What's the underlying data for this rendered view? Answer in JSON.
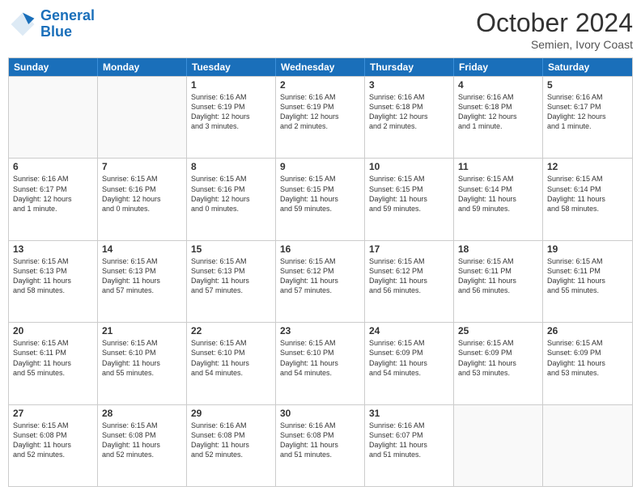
{
  "header": {
    "logo_general": "General",
    "logo_blue": "Blue",
    "month": "October 2024",
    "location": "Semien, Ivory Coast"
  },
  "days_of_week": [
    "Sunday",
    "Monday",
    "Tuesday",
    "Wednesday",
    "Thursday",
    "Friday",
    "Saturday"
  ],
  "weeks": [
    [
      {
        "day": "",
        "empty": true
      },
      {
        "day": "",
        "empty": true
      },
      {
        "day": "1",
        "lines": [
          "Sunrise: 6:16 AM",
          "Sunset: 6:19 PM",
          "Daylight: 12 hours",
          "and 3 minutes."
        ]
      },
      {
        "day": "2",
        "lines": [
          "Sunrise: 6:16 AM",
          "Sunset: 6:19 PM",
          "Daylight: 12 hours",
          "and 2 minutes."
        ]
      },
      {
        "day": "3",
        "lines": [
          "Sunrise: 6:16 AM",
          "Sunset: 6:18 PM",
          "Daylight: 12 hours",
          "and 2 minutes."
        ]
      },
      {
        "day": "4",
        "lines": [
          "Sunrise: 6:16 AM",
          "Sunset: 6:18 PM",
          "Daylight: 12 hours",
          "and 1 minute."
        ]
      },
      {
        "day": "5",
        "lines": [
          "Sunrise: 6:16 AM",
          "Sunset: 6:17 PM",
          "Daylight: 12 hours",
          "and 1 minute."
        ]
      }
    ],
    [
      {
        "day": "6",
        "lines": [
          "Sunrise: 6:16 AM",
          "Sunset: 6:17 PM",
          "Daylight: 12 hours",
          "and 1 minute."
        ]
      },
      {
        "day": "7",
        "lines": [
          "Sunrise: 6:15 AM",
          "Sunset: 6:16 PM",
          "Daylight: 12 hours",
          "and 0 minutes."
        ]
      },
      {
        "day": "8",
        "lines": [
          "Sunrise: 6:15 AM",
          "Sunset: 6:16 PM",
          "Daylight: 12 hours",
          "and 0 minutes."
        ]
      },
      {
        "day": "9",
        "lines": [
          "Sunrise: 6:15 AM",
          "Sunset: 6:15 PM",
          "Daylight: 11 hours",
          "and 59 minutes."
        ]
      },
      {
        "day": "10",
        "lines": [
          "Sunrise: 6:15 AM",
          "Sunset: 6:15 PM",
          "Daylight: 11 hours",
          "and 59 minutes."
        ]
      },
      {
        "day": "11",
        "lines": [
          "Sunrise: 6:15 AM",
          "Sunset: 6:14 PM",
          "Daylight: 11 hours",
          "and 59 minutes."
        ]
      },
      {
        "day": "12",
        "lines": [
          "Sunrise: 6:15 AM",
          "Sunset: 6:14 PM",
          "Daylight: 11 hours",
          "and 58 minutes."
        ]
      }
    ],
    [
      {
        "day": "13",
        "lines": [
          "Sunrise: 6:15 AM",
          "Sunset: 6:13 PM",
          "Daylight: 11 hours",
          "and 58 minutes."
        ]
      },
      {
        "day": "14",
        "lines": [
          "Sunrise: 6:15 AM",
          "Sunset: 6:13 PM",
          "Daylight: 11 hours",
          "and 57 minutes."
        ]
      },
      {
        "day": "15",
        "lines": [
          "Sunrise: 6:15 AM",
          "Sunset: 6:13 PM",
          "Daylight: 11 hours",
          "and 57 minutes."
        ]
      },
      {
        "day": "16",
        "lines": [
          "Sunrise: 6:15 AM",
          "Sunset: 6:12 PM",
          "Daylight: 11 hours",
          "and 57 minutes."
        ]
      },
      {
        "day": "17",
        "lines": [
          "Sunrise: 6:15 AM",
          "Sunset: 6:12 PM",
          "Daylight: 11 hours",
          "and 56 minutes."
        ]
      },
      {
        "day": "18",
        "lines": [
          "Sunrise: 6:15 AM",
          "Sunset: 6:11 PM",
          "Daylight: 11 hours",
          "and 56 minutes."
        ]
      },
      {
        "day": "19",
        "lines": [
          "Sunrise: 6:15 AM",
          "Sunset: 6:11 PM",
          "Daylight: 11 hours",
          "and 55 minutes."
        ]
      }
    ],
    [
      {
        "day": "20",
        "lines": [
          "Sunrise: 6:15 AM",
          "Sunset: 6:11 PM",
          "Daylight: 11 hours",
          "and 55 minutes."
        ]
      },
      {
        "day": "21",
        "lines": [
          "Sunrise: 6:15 AM",
          "Sunset: 6:10 PM",
          "Daylight: 11 hours",
          "and 55 minutes."
        ]
      },
      {
        "day": "22",
        "lines": [
          "Sunrise: 6:15 AM",
          "Sunset: 6:10 PM",
          "Daylight: 11 hours",
          "and 54 minutes."
        ]
      },
      {
        "day": "23",
        "lines": [
          "Sunrise: 6:15 AM",
          "Sunset: 6:10 PM",
          "Daylight: 11 hours",
          "and 54 minutes."
        ]
      },
      {
        "day": "24",
        "lines": [
          "Sunrise: 6:15 AM",
          "Sunset: 6:09 PM",
          "Daylight: 11 hours",
          "and 54 minutes."
        ]
      },
      {
        "day": "25",
        "lines": [
          "Sunrise: 6:15 AM",
          "Sunset: 6:09 PM",
          "Daylight: 11 hours",
          "and 53 minutes."
        ]
      },
      {
        "day": "26",
        "lines": [
          "Sunrise: 6:15 AM",
          "Sunset: 6:09 PM",
          "Daylight: 11 hours",
          "and 53 minutes."
        ]
      }
    ],
    [
      {
        "day": "27",
        "lines": [
          "Sunrise: 6:15 AM",
          "Sunset: 6:08 PM",
          "Daylight: 11 hours",
          "and 52 minutes."
        ]
      },
      {
        "day": "28",
        "lines": [
          "Sunrise: 6:15 AM",
          "Sunset: 6:08 PM",
          "Daylight: 11 hours",
          "and 52 minutes."
        ]
      },
      {
        "day": "29",
        "lines": [
          "Sunrise: 6:16 AM",
          "Sunset: 6:08 PM",
          "Daylight: 11 hours",
          "and 52 minutes."
        ]
      },
      {
        "day": "30",
        "lines": [
          "Sunrise: 6:16 AM",
          "Sunset: 6:08 PM",
          "Daylight: 11 hours",
          "and 51 minutes."
        ]
      },
      {
        "day": "31",
        "lines": [
          "Sunrise: 6:16 AM",
          "Sunset: 6:07 PM",
          "Daylight: 11 hours",
          "and 51 minutes."
        ]
      },
      {
        "day": "",
        "empty": true
      },
      {
        "day": "",
        "empty": true
      }
    ]
  ]
}
